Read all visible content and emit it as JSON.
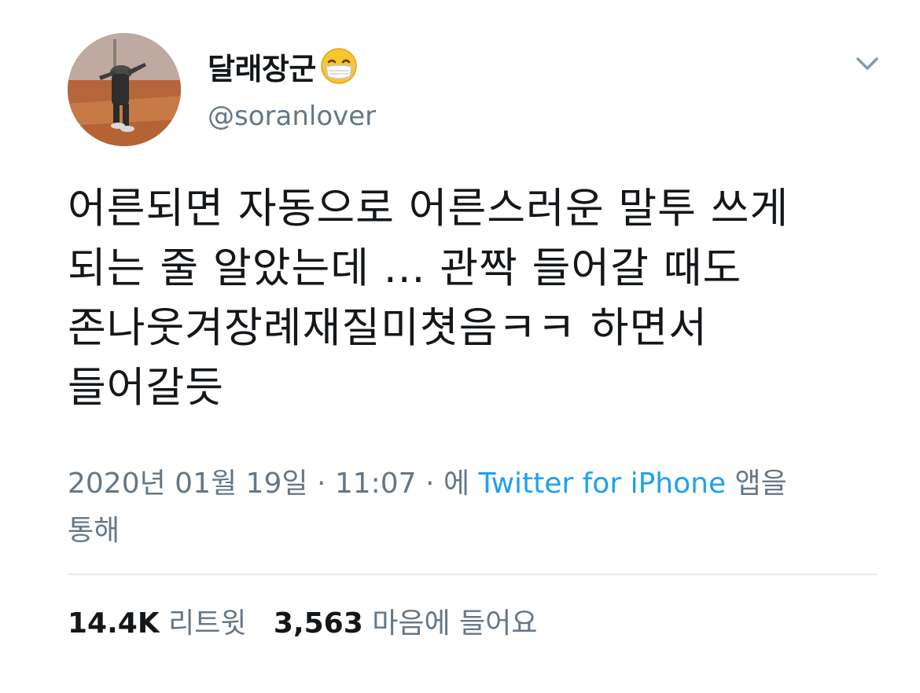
{
  "user": {
    "display_name": "달래장군",
    "name_emoji": "face-with-medical-mask",
    "handle": "@soranlover"
  },
  "tweet": {
    "lines": [
      "어른되면 자동으로 어른스러운 말투 쓰게",
      "되는 줄 알았는데 ... 관짝 들어갈 때도",
      "존나웃겨장례재질미쳣음ㅋㅋ 하면서",
      "들어갈듯"
    ]
  },
  "meta": {
    "date": "2020년 01월 19일",
    "sep1": "·",
    "time": "11:07",
    "sep2": "·",
    "prefix": "에",
    "source": "Twitter for iPhone",
    "suffix1": "앱을",
    "suffix2": "통해"
  },
  "stats": {
    "retweets_count": "14.4K",
    "retweets_label": "리트윗",
    "likes_count": "3,563",
    "likes_label": "마음에 들어요"
  },
  "colors": {
    "text": "#14171a",
    "secondary": "#657786",
    "link": "#1da1f2",
    "divider": "#e6ecf0"
  },
  "icons": {
    "menu": "chevron-down-icon",
    "emoji": "mask-emoji-icon"
  }
}
